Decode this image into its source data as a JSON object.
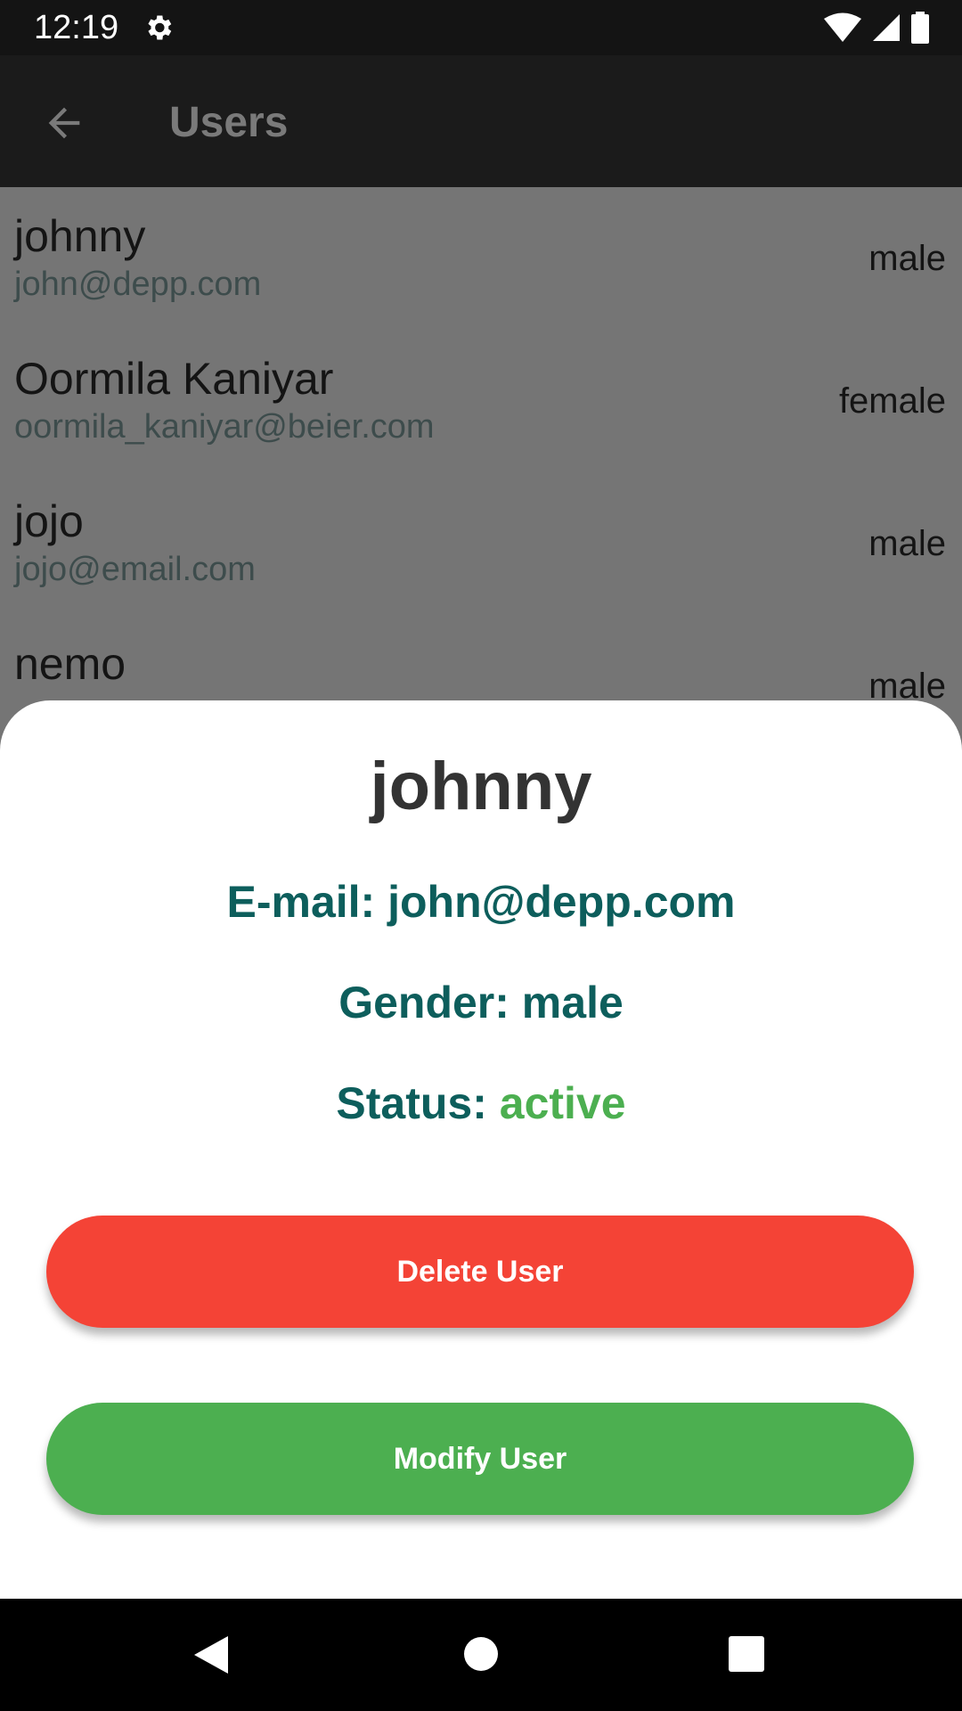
{
  "status_bar": {
    "time": "12:19",
    "icons": [
      "gear-icon",
      "wifi-icon",
      "signal-icon",
      "battery-icon"
    ]
  },
  "app_bar": {
    "title": "Users",
    "back_icon": "arrow-left-icon"
  },
  "users": [
    {
      "name": "johnny",
      "email": "john@depp.com",
      "gender": "male"
    },
    {
      "name": "Oormila Kaniyar",
      "email": "oormila_kaniyar@beier.com",
      "gender": "female"
    },
    {
      "name": "jojo",
      "email": "jojo@email.com",
      "gender": "male"
    },
    {
      "name": "nemo",
      "email": "",
      "gender": "male"
    }
  ],
  "detail_sheet": {
    "name": "johnny",
    "email_label": "E-mail: john@depp.com",
    "gender_label": "Gender: male",
    "status_prefix": "Status: ",
    "status_value": "active",
    "delete_label": "Delete User",
    "modify_label": "Modify User"
  },
  "nav_bar": {
    "icons": [
      "back-triangle-icon",
      "home-circle-icon",
      "recents-square-icon"
    ]
  },
  "colors": {
    "delete": "#f44336",
    "modify": "#4caf50",
    "detail_text": "#0d5e5c",
    "status_active": "#4caf50",
    "scrim": "#757575"
  }
}
